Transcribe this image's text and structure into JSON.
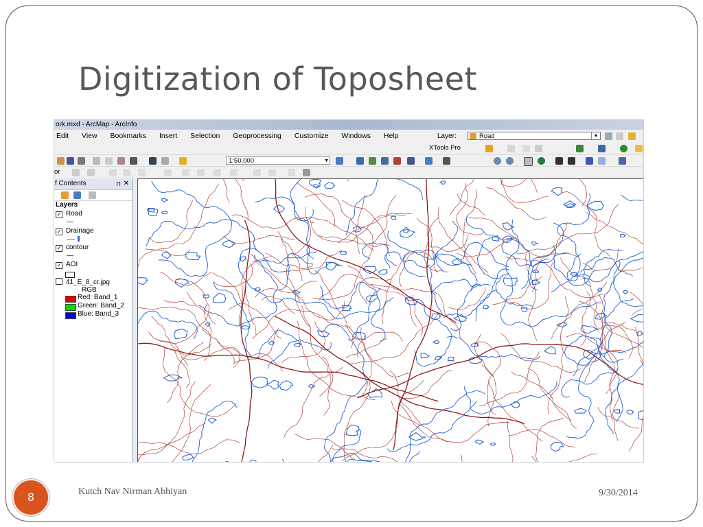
{
  "slide": {
    "title": "Digitization of Toposheet",
    "page_number": "8",
    "footer_text": "Kutch Nav Nirman Abhiyan",
    "date": "9/30/2014",
    "accent_color": "#d9541e"
  },
  "app": {
    "window_title": "ork.mxd - ArcMap - ArcInfo",
    "menu": [
      "Edit",
      "View",
      "Bookmarks",
      "Insert",
      "Selection",
      "Geoprocessing",
      "Customize",
      "Windows",
      "Help"
    ],
    "layer_label": "Layer:",
    "layer_value": "Road",
    "xtools_label": "XTools Pro",
    "scale_value": "1:50,000",
    "editor_partial": "or"
  },
  "toc": {
    "title": "f Contents",
    "pin": "∂ `",
    "close": "✕",
    "root": "Layers",
    "layers": [
      {
        "label": "Road",
        "checked": true
      },
      {
        "label": "Drainage",
        "checked": true
      },
      {
        "label": "contour",
        "checked": true
      },
      {
        "label": "AOI",
        "checked": true
      },
      {
        "label": "41_E_8_cr.jpg",
        "checked": false
      }
    ],
    "raster_mode": "RGB",
    "bands": [
      {
        "label": "Red:   Band_1",
        "color": "#e00000"
      },
      {
        "label": "Green: Band_2",
        "color": "#00dd00"
      },
      {
        "label": "Blue:   Band_3",
        "color": "#0000e0"
      }
    ]
  },
  "map": {
    "road_color": "#8b1a1a",
    "drainage_color": "#b0403a",
    "contour_color": "#1f5fd0"
  }
}
